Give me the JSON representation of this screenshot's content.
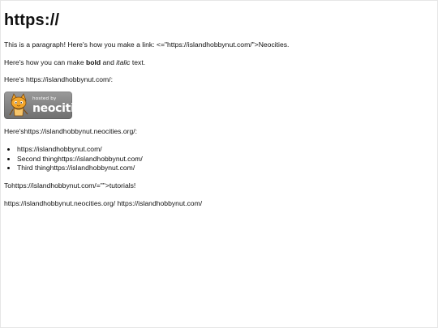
{
  "heading": "https://",
  "paragraph1": "This is a paragraph! Here's how you make a link: <=\"https://islandhobbynut.com/\">Neocities.",
  "paragraph2": {
    "before": "Here's how you can make ",
    "bold": "bold",
    "middle": " and ",
    "italic": "italic",
    "after": " text."
  },
  "paragraph3": "Here's https://islandhobbynut.com/:",
  "badge": {
    "small": "hosted by",
    "big": "neocities",
    "colors": {
      "bg_top": "#9a9a9a",
      "bg_bottom": "#6f6f6f",
      "cat_orange": "#f4a62a",
      "cat_dark": "#7a4a10"
    }
  },
  "paragraph4": "Here'shttps://islandhobbynut.neocities.org/:",
  "list_items": [
    "https://islandhobbynut.com/",
    "Second thinghttps://islandhobbynut.com/",
    "Third thinghttps://islandhobbynut.com/"
  ],
  "paragraph5": "Tohttps://islandhobbynut.com/=\"\">tutorials!",
  "paragraph6": "https://islandhobbynut.neocities.org/ https://islandhobbynut.com/"
}
